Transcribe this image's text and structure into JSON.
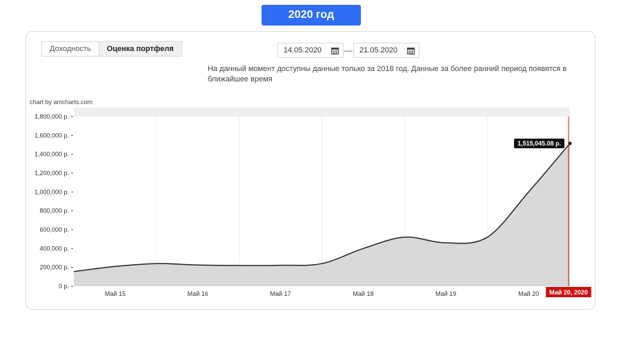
{
  "header": {
    "year_button": "2020 год"
  },
  "tabs": [
    {
      "label": "Доходность",
      "active": false
    },
    {
      "label": "Оценка портфеля",
      "active": true
    }
  ],
  "date_range": {
    "from": "14.05.2020",
    "separator": "—",
    "to": "21.05.2020"
  },
  "notice": "На данный момент доступны данные только за 2018 год. Данные за более ранний период появятся в ближайшее время",
  "credit": "chart by amcharts.com",
  "colors": {
    "accent": "#2f6df6",
    "cursor": "#cc1111",
    "area_fill": "#d9d9d9",
    "line": "#222222"
  },
  "chart_data": {
    "type": "area",
    "title": "",
    "xlabel": "",
    "ylabel": "",
    "x_ticks": [
      "Май 15",
      "Май 16",
      "Май 17",
      "Май 18",
      "Май 19",
      "Май 20"
    ],
    "y_ticks": [
      "0 р.",
      "200,000 р.",
      "400,000 р.",
      "600,000 р.",
      "800,000 р.",
      "1,000,000 р.",
      "1,200,000 р.",
      "1,400,000 р.",
      "1,600,000 р.",
      "1,800,000 р."
    ],
    "ylim": [
      0,
      1800000
    ],
    "xlim": [
      0,
      6
    ],
    "x": [
      0,
      0.5,
      1.0,
      1.5,
      2.0,
      2.5,
      3.0,
      3.5,
      4.0,
      4.5,
      5.0,
      5.5,
      6.0
    ],
    "values": [
      155000,
      210000,
      240000,
      225000,
      220000,
      222000,
      240000,
      400000,
      520000,
      460000,
      520000,
      1000000,
      1515045.08
    ],
    "cursor": {
      "x_label": "Май 20, 2020",
      "value_label": "1,515,045.08 р."
    }
  }
}
